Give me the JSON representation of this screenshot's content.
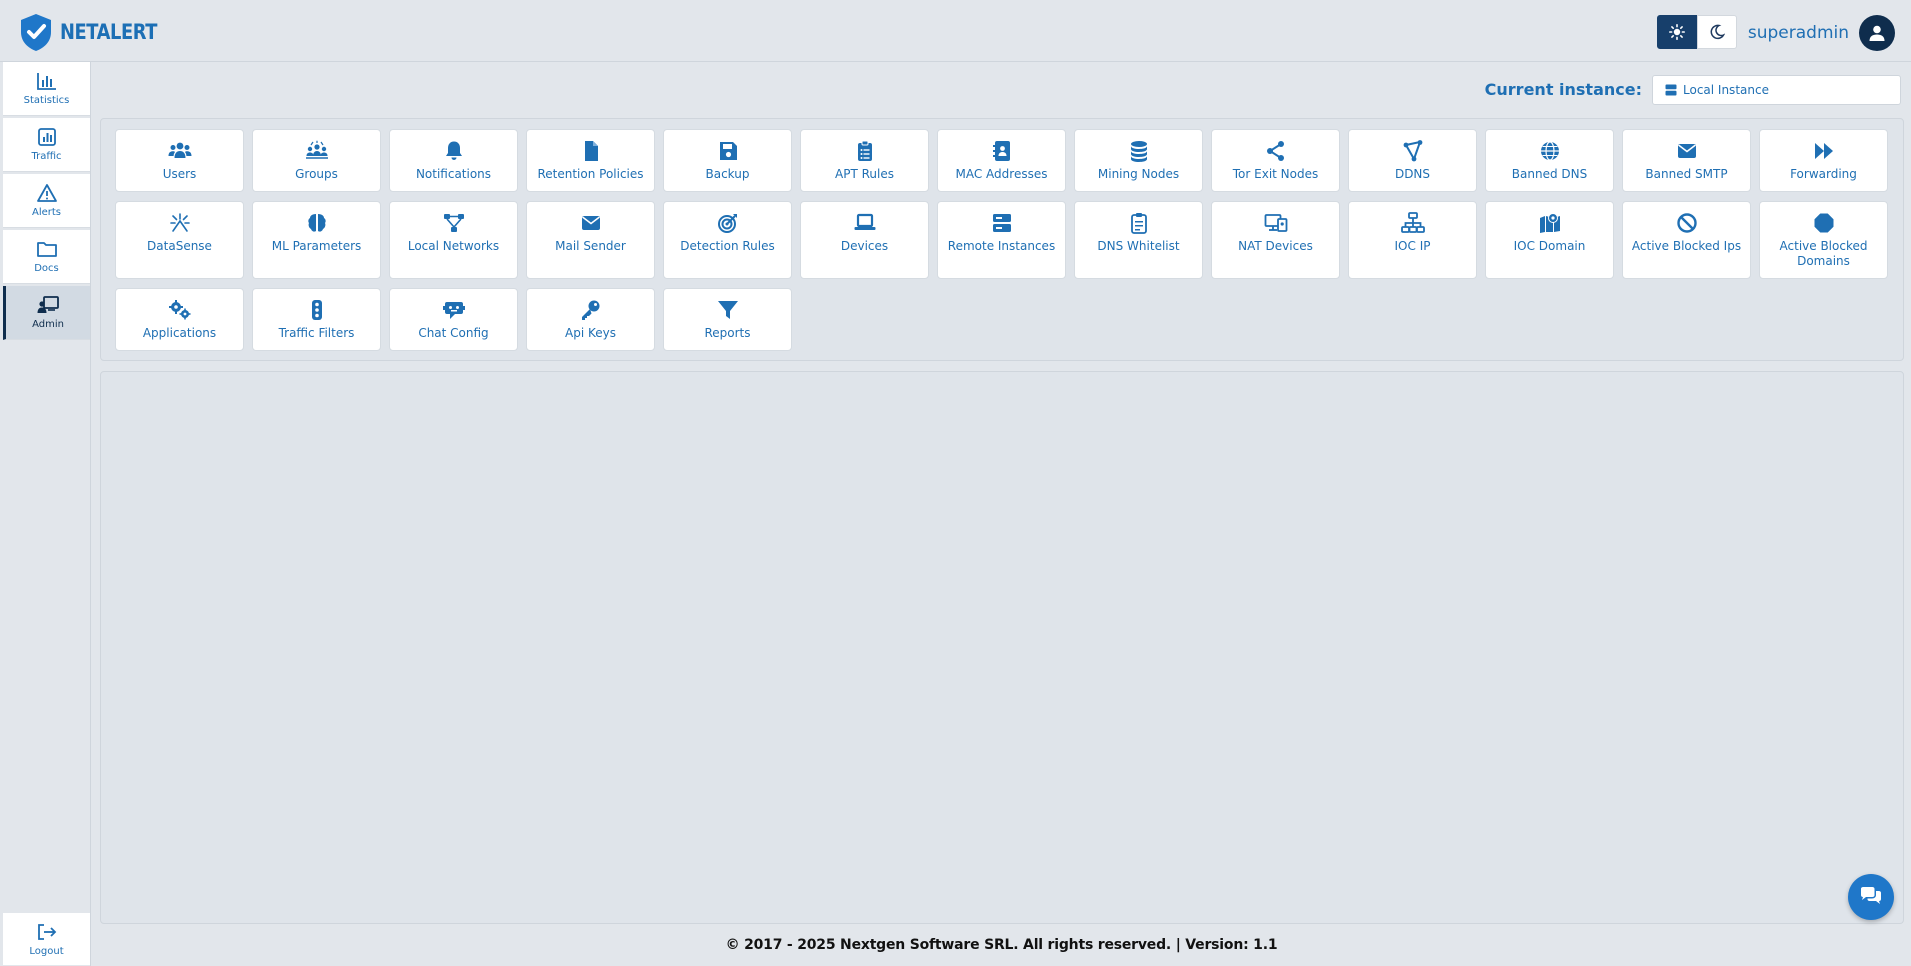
{
  "brand": {
    "name": "NETALERT"
  },
  "header": {
    "username": "superadmin",
    "theme_light": "sun-icon",
    "theme_dark": "moon-icon"
  },
  "sidebar": {
    "items": [
      {
        "label": "Statistics",
        "icon": "chart-icon"
      },
      {
        "label": "Traffic",
        "icon": "traffic-chart-icon"
      },
      {
        "label": "Alerts",
        "icon": "warning-icon"
      },
      {
        "label": "Docs",
        "icon": "folder-icon"
      },
      {
        "label": "Admin",
        "icon": "admin-icon",
        "active": true
      }
    ],
    "logout": {
      "label": "Logout",
      "icon": "logout-icon"
    }
  },
  "instance": {
    "label": "Current instance:",
    "selected": "Local Instance"
  },
  "tiles": [
    {
      "label": "Users",
      "icon": "users-icon"
    },
    {
      "label": "Groups",
      "icon": "groups-icon"
    },
    {
      "label": "Notifications",
      "icon": "bell-icon"
    },
    {
      "label": "Retention Policies",
      "icon": "file-icon"
    },
    {
      "label": "Backup",
      "icon": "save-icon"
    },
    {
      "label": "APT Rules",
      "icon": "clipboard-list-icon"
    },
    {
      "label": "MAC Addresses",
      "icon": "address-book-icon"
    },
    {
      "label": "Mining Nodes",
      "icon": "coins-icon"
    },
    {
      "label": "Tor Exit Nodes",
      "icon": "share-nodes-icon"
    },
    {
      "label": "DDNS",
      "icon": "ddns-icon"
    },
    {
      "label": "Banned DNS",
      "icon": "globe-icon"
    },
    {
      "label": "Banned SMTP",
      "icon": "envelope-icon"
    },
    {
      "label": "Forwarding",
      "icon": "forward-icon"
    },
    {
      "label": "DataSense",
      "icon": "sparkle-icon"
    },
    {
      "label": "ML Parameters",
      "icon": "brain-icon"
    },
    {
      "label": "Local Networks",
      "icon": "network-icon"
    },
    {
      "label": "Mail Sender",
      "icon": "mail-icon"
    },
    {
      "label": "Detection Rules",
      "icon": "target-icon"
    },
    {
      "label": "Devices",
      "icon": "laptop-icon"
    },
    {
      "label": "Remote Instances",
      "icon": "server-icon"
    },
    {
      "label": "DNS Whitelist",
      "icon": "clipboard-check-icon"
    },
    {
      "label": "NAT Devices",
      "icon": "devices-icon"
    },
    {
      "label": "IOC IP",
      "icon": "sitemap-icon"
    },
    {
      "label": "IOC Domain",
      "icon": "map-location-icon"
    },
    {
      "label": "Active Blocked Ips",
      "icon": "ban-icon"
    },
    {
      "label": "Active Blocked Domains",
      "icon": "stop-icon"
    },
    {
      "label": "Applications",
      "icon": "gears-icon"
    },
    {
      "label": "Traffic Filters",
      "icon": "traffic-light-icon"
    },
    {
      "label": "Chat Config",
      "icon": "chat-bot-icon"
    },
    {
      "label": "Api Keys",
      "icon": "key-icon"
    },
    {
      "label": "Reports",
      "icon": "filter-icon"
    }
  ],
  "footer": {
    "text": "© 2017 - 2025 Nextgen Software SRL. All rights reserved. | Version: 1.1"
  },
  "colors": {
    "accent": "#1f6fb3",
    "dark": "#0f2d4d",
    "background": "#e2e6eb"
  }
}
